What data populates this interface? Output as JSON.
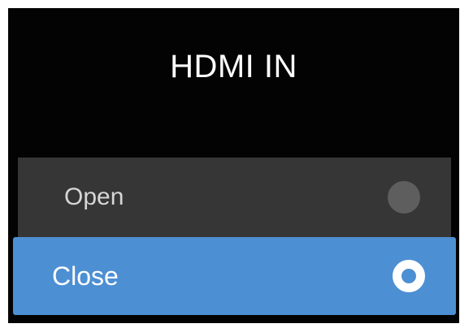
{
  "dialog": {
    "title": "HDMI IN",
    "options": [
      {
        "label": "Open",
        "selected": false
      },
      {
        "label": "Close",
        "selected": true
      }
    ]
  },
  "colors": {
    "background": "#030303",
    "option_bg": "#363636",
    "selected_bg": "#4d8fd3",
    "radio_off": "#5e5e5e",
    "radio_on_ring": "#ffffff"
  }
}
